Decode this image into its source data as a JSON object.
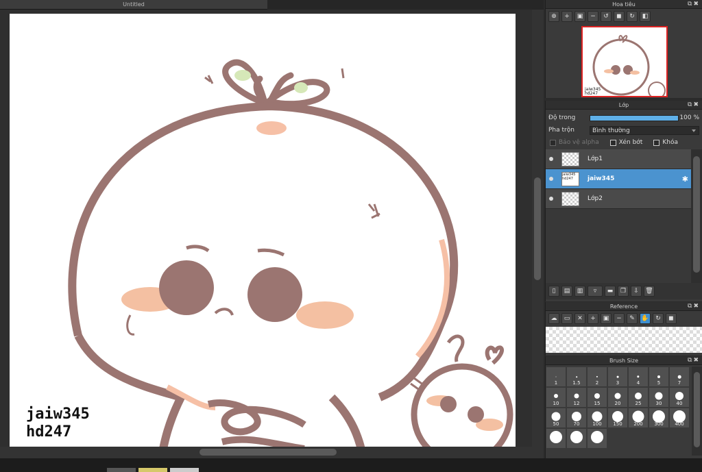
{
  "document": {
    "title": "Untitled"
  },
  "canvas": {
    "signature_lines": [
      "jaiw345",
      "hd247"
    ]
  },
  "navigator": {
    "title": "Hoa tiêu",
    "tools": [
      "zoom-fit-icon",
      "zoom-in-icon",
      "fit-window-icon",
      "zoom-out-icon",
      "rotate-left-icon",
      "reset-view-icon",
      "rotate-right-icon",
      "flip-icon"
    ]
  },
  "layer_panel": {
    "title": "Lớp",
    "opacity_label": "Độ trong",
    "opacity_value": "100 %",
    "opacity_fraction": 1.0,
    "blend_label": "Pha trộn",
    "blend_value": "Bình thường",
    "protect_alpha": "Bảo vệ alpha",
    "clipping": "Xén bớt",
    "lock": "Khóa",
    "layers": [
      {
        "name": "Lớp1",
        "active": false
      },
      {
        "name": "jaiw345",
        "active": true,
        "thumb_text": "jaiw345 hd247"
      },
      {
        "name": "Lớp2",
        "active": false
      }
    ]
  },
  "reference": {
    "title": "Reference"
  },
  "brush_size": {
    "title": "Brush Size",
    "sizes": [
      "1",
      "1.5",
      "2",
      "3",
      "4",
      "5",
      "7",
      "10",
      "12",
      "15",
      "20",
      "25",
      "30",
      "40",
      "50",
      "70",
      "100",
      "150",
      "200",
      "300",
      "400",
      "",
      "",
      ""
    ]
  },
  "colors": {
    "accent": "#4b93cf",
    "line": "#9b7571",
    "blush": "#f4b9a0",
    "leaf": "#d6e8b8"
  }
}
